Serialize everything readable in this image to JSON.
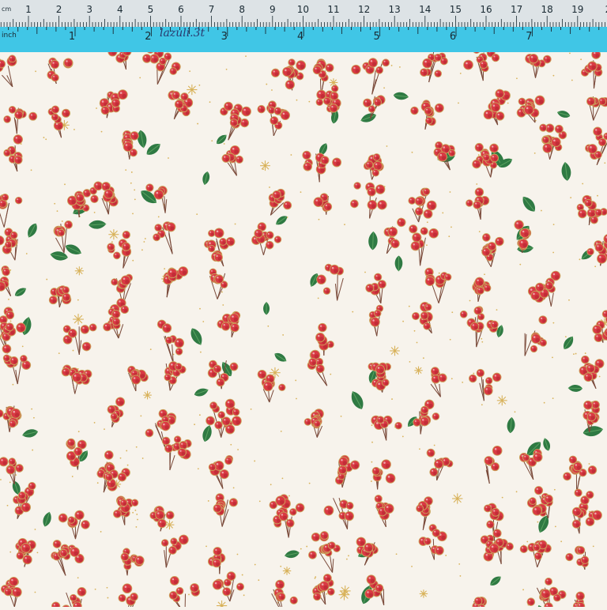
{
  "ruler": {
    "unit_cm": "cm",
    "unit_inch": "inch",
    "handwritten_note": "lazuli.3t",
    "cm_labels": [
      "1",
      "2",
      "3",
      "4",
      "5",
      "6",
      "7",
      "8",
      "9",
      "10",
      "11",
      "12",
      "13",
      "14",
      "15",
      "16",
      "17",
      "18",
      "19",
      "2"
    ],
    "inch_labels": [
      "1",
      "2",
      "3",
      "4",
      "5",
      "6",
      "7"
    ],
    "colors": {
      "cm_band": "#dde3e6",
      "inch_band": "#40c6e6",
      "tick": "#1a2a33"
    }
  },
  "fabric": {
    "pattern": "red berry clusters with green leaves and gold stars",
    "colors": {
      "background": "#f7f3ec",
      "berry": "#d93a43",
      "berry_shade": "#b22430",
      "berry_outline": "#c9a25a",
      "leaf": "#2f7a43",
      "leaf_light": "#5aa260",
      "stem": "#7a4a3a",
      "star": "#d8b25a"
    }
  }
}
